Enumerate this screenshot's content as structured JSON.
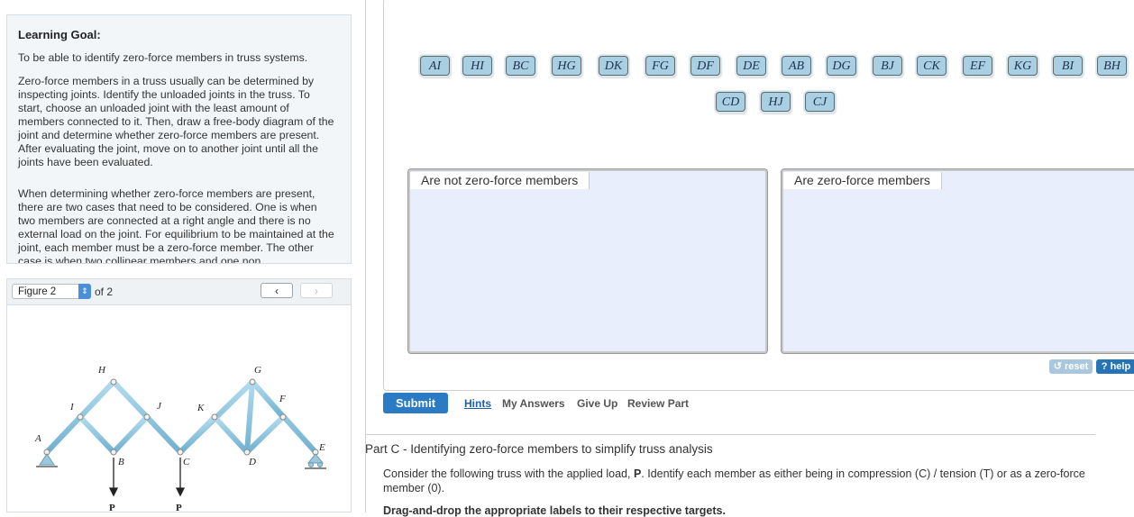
{
  "learning_goal": {
    "title": "Learning Goal:",
    "p1": "To be able to identify zero-force members in truss systems.",
    "p2": "Zero-force members in a truss usually can be determined by inspecting joints. Identify the unloaded joints in the truss. To start, choose an unloaded joint with the least amount of members connected to it. Then, draw a free-body diagram of the joint and determine whether zero-force members are present. After evaluating the joint, move on to another joint until all the joints have been evaluated.",
    "p3": "When determining whether zero-force members are present, there are two cases that need to be considered. One is when two members are connected at a right angle and there is no external load on the joint. For equilibrium to be maintained at the joint, each member must be a zero-force member. The other case is when two collinear members and one non"
  },
  "figure": {
    "selected": "Figure 2",
    "of_label": "of 2",
    "prev": "‹",
    "next": "›",
    "joint_labels": {
      "A": "A",
      "B": "B",
      "C": "C",
      "D": "D",
      "E": "E",
      "F": "F",
      "G": "G",
      "H": "H",
      "I": "I",
      "J": "J",
      "K": "K"
    },
    "load_label": "P"
  },
  "tiles": [
    "AI",
    "HI",
    "BC",
    "HG",
    "DK",
    "FG",
    "DF",
    "DE",
    "AB",
    "DG",
    "BJ",
    "CK",
    "EF",
    "KG",
    "BI",
    "BH",
    "CD",
    "HJ",
    "CJ"
  ],
  "targets": {
    "not_zero": "Are not zero-force members",
    "zero": "Are zero-force members"
  },
  "controls": {
    "reset": "reset",
    "help": "? help"
  },
  "actions": {
    "submit": "Submit",
    "hints": "Hints",
    "my_answers": "My Answers",
    "give_up": "Give Up",
    "review_part": "Review Part"
  },
  "part_c": {
    "title": "Part C - Identifying zero-force members to simplify truss analysis",
    "desc_before": "Consider the following truss with the applied load, ",
    "desc_bold": "P",
    "desc_after": ". Identify each member as either being in compression (C) / tension (T) or as a zero-force member (0).",
    "instruction": "Drag-and-drop the appropriate labels to their respective targets."
  },
  "colors": {
    "tile": "#a9cfe3",
    "target": "#e8eefb",
    "submit": "#2a7ac4",
    "help": "#2673b6",
    "truss": "#8fc6df"
  }
}
